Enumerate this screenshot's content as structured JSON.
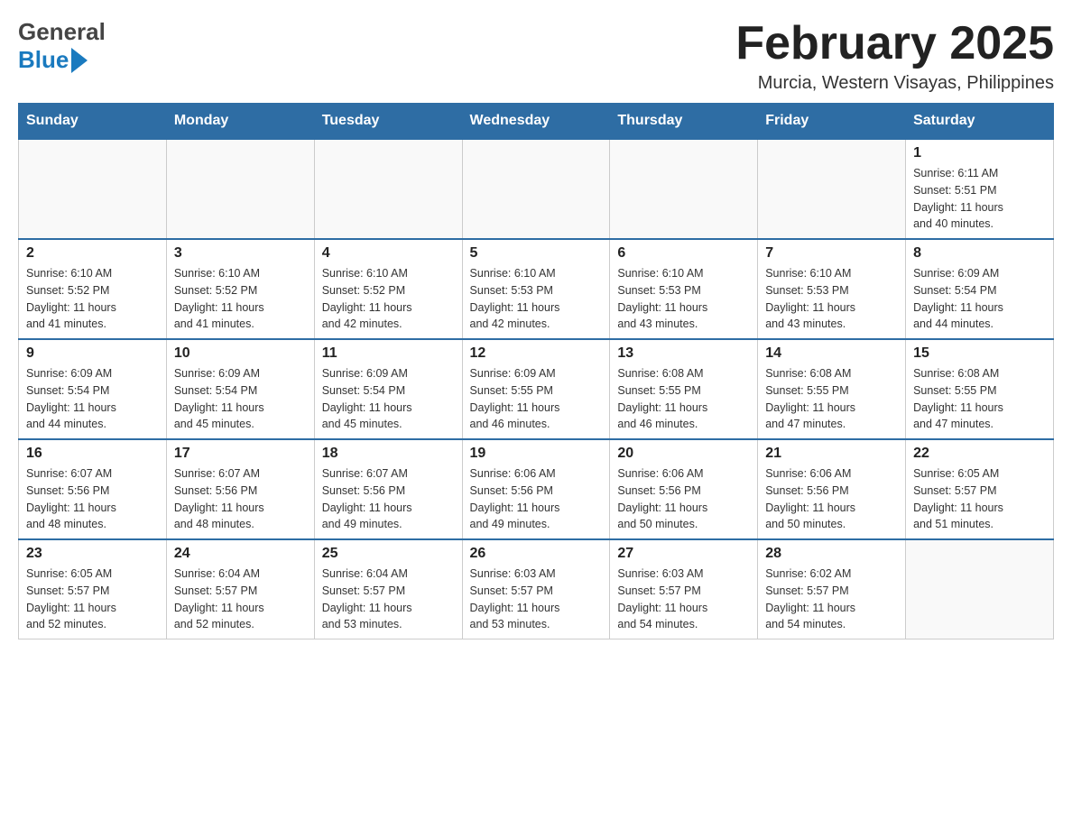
{
  "header": {
    "logo_general": "General",
    "logo_blue": "Blue",
    "month_title": "February 2025",
    "location": "Murcia, Western Visayas, Philippines"
  },
  "weekdays": [
    "Sunday",
    "Monday",
    "Tuesday",
    "Wednesday",
    "Thursday",
    "Friday",
    "Saturday"
  ],
  "weeks": [
    [
      {
        "day": "",
        "info": ""
      },
      {
        "day": "",
        "info": ""
      },
      {
        "day": "",
        "info": ""
      },
      {
        "day": "",
        "info": ""
      },
      {
        "day": "",
        "info": ""
      },
      {
        "day": "",
        "info": ""
      },
      {
        "day": "1",
        "info": "Sunrise: 6:11 AM\nSunset: 5:51 PM\nDaylight: 11 hours\nand 40 minutes."
      }
    ],
    [
      {
        "day": "2",
        "info": "Sunrise: 6:10 AM\nSunset: 5:52 PM\nDaylight: 11 hours\nand 41 minutes."
      },
      {
        "day": "3",
        "info": "Sunrise: 6:10 AM\nSunset: 5:52 PM\nDaylight: 11 hours\nand 41 minutes."
      },
      {
        "day": "4",
        "info": "Sunrise: 6:10 AM\nSunset: 5:52 PM\nDaylight: 11 hours\nand 42 minutes."
      },
      {
        "day": "5",
        "info": "Sunrise: 6:10 AM\nSunset: 5:53 PM\nDaylight: 11 hours\nand 42 minutes."
      },
      {
        "day": "6",
        "info": "Sunrise: 6:10 AM\nSunset: 5:53 PM\nDaylight: 11 hours\nand 43 minutes."
      },
      {
        "day": "7",
        "info": "Sunrise: 6:10 AM\nSunset: 5:53 PM\nDaylight: 11 hours\nand 43 minutes."
      },
      {
        "day": "8",
        "info": "Sunrise: 6:09 AM\nSunset: 5:54 PM\nDaylight: 11 hours\nand 44 minutes."
      }
    ],
    [
      {
        "day": "9",
        "info": "Sunrise: 6:09 AM\nSunset: 5:54 PM\nDaylight: 11 hours\nand 44 minutes."
      },
      {
        "day": "10",
        "info": "Sunrise: 6:09 AM\nSunset: 5:54 PM\nDaylight: 11 hours\nand 45 minutes."
      },
      {
        "day": "11",
        "info": "Sunrise: 6:09 AM\nSunset: 5:54 PM\nDaylight: 11 hours\nand 45 minutes."
      },
      {
        "day": "12",
        "info": "Sunrise: 6:09 AM\nSunset: 5:55 PM\nDaylight: 11 hours\nand 46 minutes."
      },
      {
        "day": "13",
        "info": "Sunrise: 6:08 AM\nSunset: 5:55 PM\nDaylight: 11 hours\nand 46 minutes."
      },
      {
        "day": "14",
        "info": "Sunrise: 6:08 AM\nSunset: 5:55 PM\nDaylight: 11 hours\nand 47 minutes."
      },
      {
        "day": "15",
        "info": "Sunrise: 6:08 AM\nSunset: 5:55 PM\nDaylight: 11 hours\nand 47 minutes."
      }
    ],
    [
      {
        "day": "16",
        "info": "Sunrise: 6:07 AM\nSunset: 5:56 PM\nDaylight: 11 hours\nand 48 minutes."
      },
      {
        "day": "17",
        "info": "Sunrise: 6:07 AM\nSunset: 5:56 PM\nDaylight: 11 hours\nand 48 minutes."
      },
      {
        "day": "18",
        "info": "Sunrise: 6:07 AM\nSunset: 5:56 PM\nDaylight: 11 hours\nand 49 minutes."
      },
      {
        "day": "19",
        "info": "Sunrise: 6:06 AM\nSunset: 5:56 PM\nDaylight: 11 hours\nand 49 minutes."
      },
      {
        "day": "20",
        "info": "Sunrise: 6:06 AM\nSunset: 5:56 PM\nDaylight: 11 hours\nand 50 minutes."
      },
      {
        "day": "21",
        "info": "Sunrise: 6:06 AM\nSunset: 5:56 PM\nDaylight: 11 hours\nand 50 minutes."
      },
      {
        "day": "22",
        "info": "Sunrise: 6:05 AM\nSunset: 5:57 PM\nDaylight: 11 hours\nand 51 minutes."
      }
    ],
    [
      {
        "day": "23",
        "info": "Sunrise: 6:05 AM\nSunset: 5:57 PM\nDaylight: 11 hours\nand 52 minutes."
      },
      {
        "day": "24",
        "info": "Sunrise: 6:04 AM\nSunset: 5:57 PM\nDaylight: 11 hours\nand 52 minutes."
      },
      {
        "day": "25",
        "info": "Sunrise: 6:04 AM\nSunset: 5:57 PM\nDaylight: 11 hours\nand 53 minutes."
      },
      {
        "day": "26",
        "info": "Sunrise: 6:03 AM\nSunset: 5:57 PM\nDaylight: 11 hours\nand 53 minutes."
      },
      {
        "day": "27",
        "info": "Sunrise: 6:03 AM\nSunset: 5:57 PM\nDaylight: 11 hours\nand 54 minutes."
      },
      {
        "day": "28",
        "info": "Sunrise: 6:02 AM\nSunset: 5:57 PM\nDaylight: 11 hours\nand 54 minutes."
      },
      {
        "day": "",
        "info": ""
      }
    ]
  ]
}
